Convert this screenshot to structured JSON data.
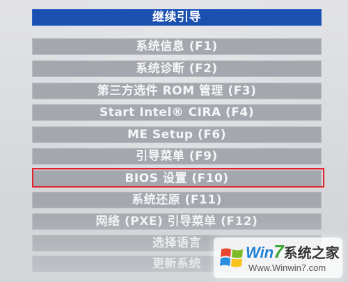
{
  "menu": {
    "items": [
      {
        "label": "继续引导",
        "state": "selected"
      },
      {
        "label": "系统信息 (F1)",
        "state": "normal"
      },
      {
        "label": "系统诊断 (F2)",
        "state": "normal"
      },
      {
        "label": "第三方选件 ROM 管理 (F3)",
        "state": "normal"
      },
      {
        "label": "Start Intel® CIRA (F4)",
        "state": "normal"
      },
      {
        "label": "ME Setup (F6)",
        "state": "normal"
      },
      {
        "label": "引导菜单 (F9)",
        "state": "normal"
      },
      {
        "label": "BIOS 设置 (F10)",
        "state": "highlighted"
      },
      {
        "label": "系统还原 (F11)",
        "state": "normal"
      },
      {
        "label": "网络 (PXE) 引导菜单 (F12)",
        "state": "normal"
      },
      {
        "label": "选择语言",
        "state": "normal"
      },
      {
        "label": "更新系统",
        "state": "normal"
      }
    ]
  },
  "watermark": {
    "title_win": "Win",
    "title_seven": "7",
    "title_cn": "系统之家",
    "url": "Www.Winwin7.com"
  },
  "colors": {
    "selected_item": "#1b4fb0",
    "normal_item": "#a4a7ad",
    "highlight_border": "#e0242f",
    "background": "#d3d5d8"
  },
  "icons": [
    "windows-logo-icon"
  ]
}
